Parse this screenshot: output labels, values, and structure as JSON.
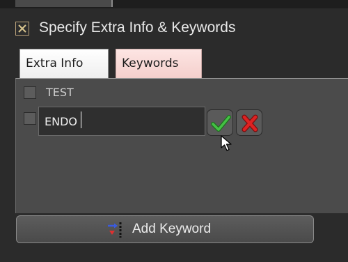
{
  "dialog": {
    "title": "Specify Extra Info & Keywords",
    "close_icon": "close-icon"
  },
  "tabs": [
    {
      "label": "Extra Info",
      "active": false
    },
    {
      "label": "Keywords",
      "active": true
    }
  ],
  "keywords": {
    "items": [
      {
        "label": "TEST",
        "checked": false
      }
    ],
    "editing": {
      "value": "ENDO",
      "checked": false
    },
    "confirm_icon": "checkmark-icon",
    "cancel_icon": "x-icon"
  },
  "add_button": {
    "label": "Add Keyword",
    "icon": "add-keyword-icon"
  },
  "colors": {
    "background": "#2b2b2b",
    "panel": "#4b4b4b",
    "confirm": "#3aa43a",
    "cancel": "#d02020",
    "keywords_tab": "#f4cfcc"
  }
}
